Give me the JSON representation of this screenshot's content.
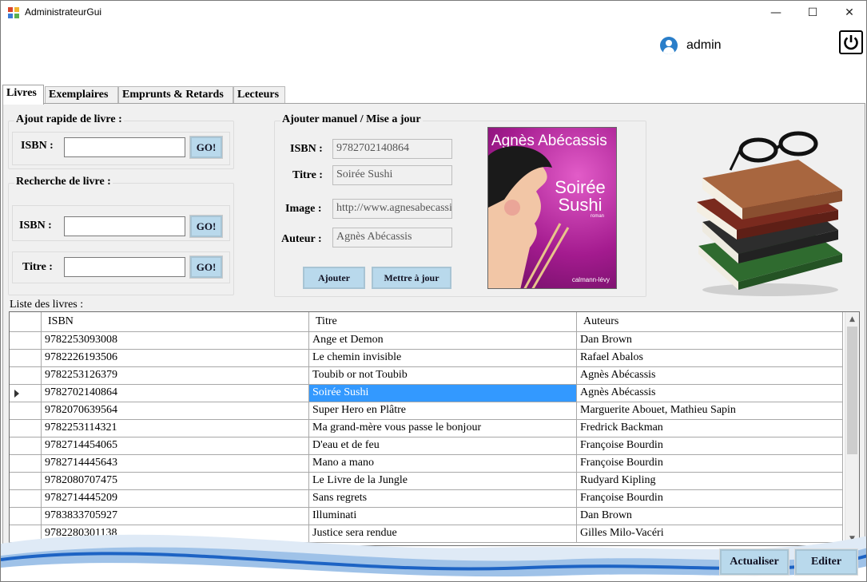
{
  "window": {
    "title": "AdministrateurGui",
    "minimize_glyph": "—",
    "maximize_glyph": "☐",
    "close_glyph": "✕"
  },
  "user": {
    "name": "admin"
  },
  "tabs": [
    "Livres",
    "Exemplaires",
    "Emprunts & Retards",
    "Lecteurs"
  ],
  "quick_add": {
    "title": "Ajout rapide de livre :",
    "isbn_label": "ISBN :",
    "isbn_value": "",
    "go_label": "GO!"
  },
  "search": {
    "title": "Recherche de livre :",
    "isbn_label": "ISBN :",
    "isbn_value": "",
    "isbn_go": "GO!",
    "title_label": "Titre :",
    "title_value": "",
    "title_go": "GO!"
  },
  "manual": {
    "title": "Ajouter manuel / Mise a jour",
    "isbn_label": "ISBN :",
    "isbn_value": "9782702140864",
    "titre_label": "Titre :",
    "titre_value": "Soirée Sushi",
    "image_label": "Image :",
    "image_value": "http://www.agnesabecassis",
    "auteur_label": "Auteur :",
    "auteur_value": "Agnès Abécassis",
    "add_label": "Ajouter",
    "update_label": "Mettre à jour"
  },
  "cover": {
    "author": "Agnès Abécassis",
    "title": "Soirée Sushi",
    "tag": "roman",
    "publisher": "calmann-lévy"
  },
  "list": {
    "label": "Liste des livres :",
    "columns": [
      "ISBN",
      "Titre",
      "Auteurs"
    ],
    "rows": [
      [
        "9782253093008",
        "Ange et Demon",
        "Dan Brown"
      ],
      [
        "9782226193506",
        "Le chemin invisible",
        "Rafael Abalos"
      ],
      [
        "9782253126379",
        "Toubib or not Toubib",
        "Agnès Abécassis"
      ],
      [
        "9782702140864",
        "Soirée Sushi",
        "Agnès Abécassis"
      ],
      [
        "9782070639564",
        "Super Hero en Plâtre",
        "Marguerite Abouet,  Mathieu Sapin"
      ],
      [
        "9782253114321",
        "Ma grand-mère vous passe le bonjour",
        "Fredrick Backman"
      ],
      [
        "9782714454065",
        "D'eau et de feu",
        "Françoise Bourdin"
      ],
      [
        "9782714445643",
        "Mano a mano",
        "Françoise Bourdin"
      ],
      [
        "9782080707475",
        "Le Livre de la Jungle",
        "Rudyard Kipling"
      ],
      [
        "9782714445209",
        "Sans regrets",
        "Françoise Bourdin"
      ],
      [
        "9783833705927",
        "Illuminati",
        "Dan Brown"
      ],
      [
        "9782280301138",
        "Justice sera rendue",
        "Gilles Milo-Vacéri"
      ]
    ],
    "selected_row": 3,
    "selected_col": 1
  },
  "footer": {
    "refresh_label": "Actualiser",
    "edit_label": "Editer"
  }
}
